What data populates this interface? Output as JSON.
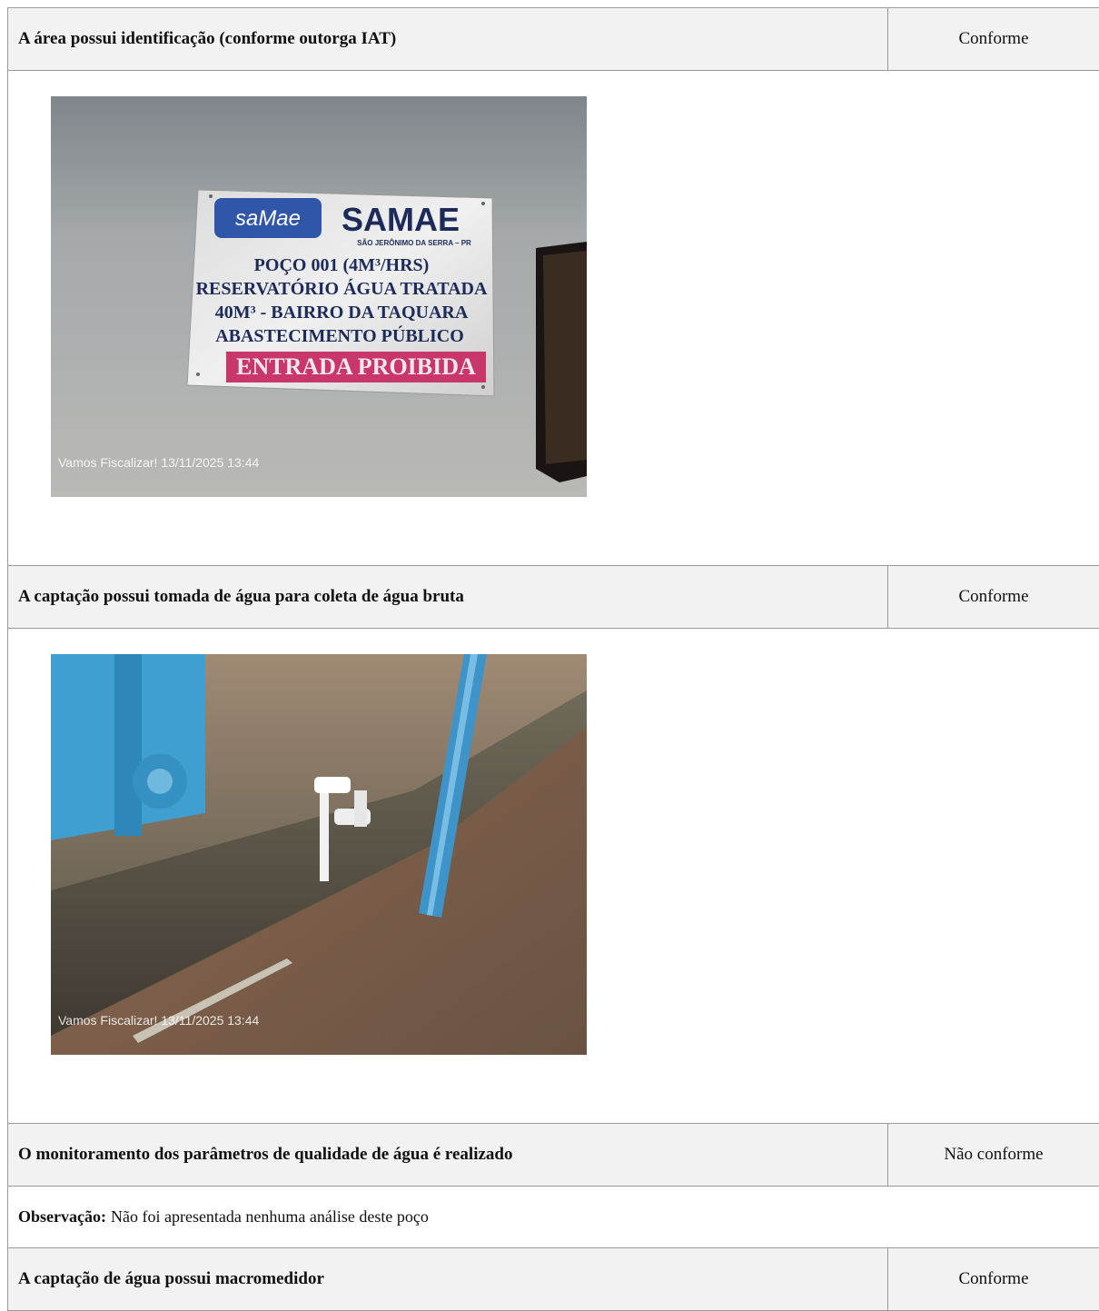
{
  "items": [
    {
      "question": "A área possui identificação (conforme outorga IAT)",
      "status": "Conforme",
      "photo": {
        "stamp": "Vamos Fiscalizar!  13/11/2025 13:44",
        "sign": {
          "logo_text": "saMae",
          "brand": "SAMAE",
          "city": "SÃO JERÔNIMO DA SERRA – PR",
          "lines": [
            "POÇO 001 (4M³/HRS)",
            "RESERVATÓRIO ÁGUA TRATADA",
            "40M³ - BAIRRO DA TAQUARA",
            "ABASTECIMENTO PÚBLICO"
          ],
          "warning": "ENTRADA PROIBIDA"
        }
      }
    },
    {
      "question": "A captação possui tomada de água para coleta de água bruta",
      "status": "Conforme",
      "photo": {
        "stamp": "Vamos Fiscalizar!  13/11/2025 13:44"
      }
    },
    {
      "question": "O monitoramento dos parâmetros de qualidade de água é realizado",
      "status": "Não conforme",
      "observation_label": "Observação:",
      "observation_text": "Não foi apresentada nenhuma análise deste poço"
    },
    {
      "question": "A captação de água possui macromedidor",
      "status": "Conforme"
    }
  ]
}
